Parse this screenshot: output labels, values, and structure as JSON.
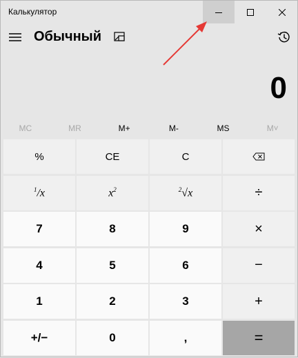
{
  "window": {
    "title": "Калькулятор"
  },
  "header": {
    "mode_title": "Обычный"
  },
  "display": {
    "value": "0"
  },
  "memory": [
    {
      "label": "MC",
      "enabled": false
    },
    {
      "label": "MR",
      "enabled": false
    },
    {
      "label": "M+",
      "enabled": true
    },
    {
      "label": "M-",
      "enabled": true
    },
    {
      "label": "MS",
      "enabled": true
    },
    {
      "label": "M˅",
      "enabled": false
    }
  ],
  "keys": {
    "percent": "%",
    "ce": "CE",
    "c": "C",
    "backspace": "⌫",
    "reciprocal_num": "1",
    "reciprocal_x": "x",
    "square_x": "x",
    "square_exp": "2",
    "sqrt_idx": "2",
    "sqrt_x": "x",
    "divide": "÷",
    "seven": "7",
    "eight": "8",
    "nine": "9",
    "multiply": "×",
    "four": "4",
    "five": "5",
    "six": "6",
    "minus": "−",
    "one": "1",
    "two": "2",
    "three": "3",
    "plus": "+",
    "negate": "+/−",
    "zero": "0",
    "decimal": ",",
    "equals": "="
  },
  "icons": [
    "hamburger-icon",
    "keep-on-top-icon",
    "history-icon",
    "minimize-icon",
    "maximize-icon",
    "close-icon",
    "red-arrow-annotation"
  ],
  "colors": {
    "window_bg": "#e6e6e6",
    "key_bg": "#f0f0f0",
    "num_key_bg": "#fafafa",
    "equals_bg": "#a6a6a6",
    "arrow": "#e53935"
  }
}
